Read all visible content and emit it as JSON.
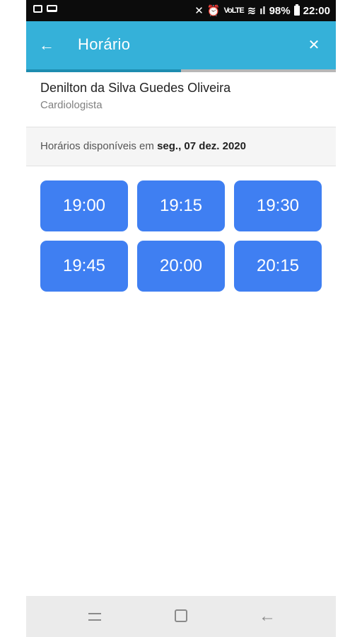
{
  "status_bar": {
    "signal_labels": "VoLTE",
    "battery": "98%",
    "time": "22:00"
  },
  "appbar": {
    "title": "Horário",
    "back_icon": "arrow-left-icon",
    "close_icon": "close-icon"
  },
  "progress": {
    "fraction": 0.5
  },
  "doctor": {
    "name": "Denilton da Silva Guedes Oliveira",
    "specialty": "Cardiologista"
  },
  "availability": {
    "prefix": "Horários disponíveis em",
    "date": "seg., 07 dez. 2020"
  },
  "slots": [
    "19:00",
    "19:15",
    "19:30",
    "19:45",
    "20:00",
    "20:15"
  ],
  "colors": {
    "appbar": "#35b1d9",
    "slot": "#3f7ff2"
  }
}
